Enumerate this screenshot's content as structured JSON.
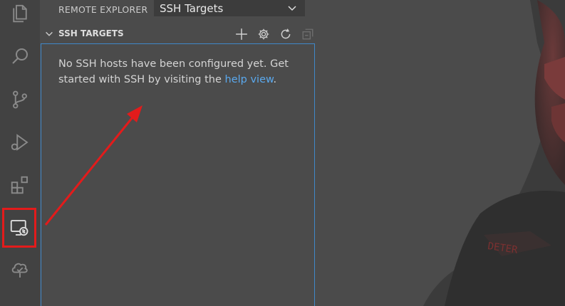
{
  "sidebar": {
    "title": "REMOTE EXPLORER",
    "dropdown_value": "SSH Targets",
    "section_title": "SSH TARGETS",
    "message_before": "No SSH hosts have been configured yet. Get started with SSH by visiting the ",
    "message_link": "help view",
    "message_after": "."
  },
  "activity_bar": {
    "items": [
      "explorer-icon",
      "search-icon",
      "source-control-icon",
      "run-debug-icon",
      "extensions-icon",
      "remote-explorer-icon",
      "tree-check-icon"
    ]
  },
  "section_actions": [
    "add-icon",
    "gear-icon",
    "refresh-icon",
    "collapse-all-icon"
  ],
  "colors": {
    "annotation_red": "#e31b1b",
    "focus_border": "#3f88c9",
    "link": "#5aa9ee"
  }
}
